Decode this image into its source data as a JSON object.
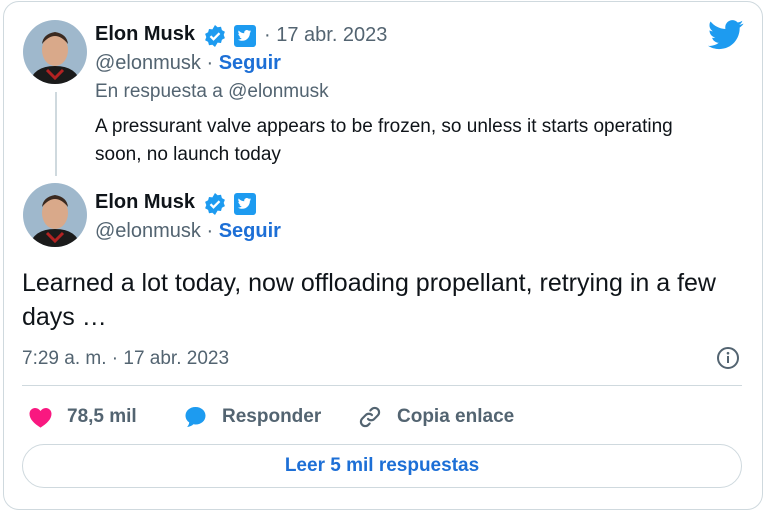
{
  "reply_tweet": {
    "author_name": "Elon Musk",
    "date": "· 17 abr. 2023",
    "handle": "@elonmusk ·",
    "follow_label": "Seguir",
    "reply_to": "En respuesta a @elonmusk",
    "text": "A pressurant valve appears to be frozen, so unless it starts operating soon, no launch today"
  },
  "main_tweet": {
    "author_name": "Elon Musk",
    "handle": "@elonmusk ·",
    "follow_label": "Seguir",
    "text": "Learned a lot today, now offloading propellant, retrying in a few days …",
    "timestamp": "7:29 a. m. · 17 abr. 2023"
  },
  "actions": {
    "likes": "78,5 mil",
    "reply_label": "Responder",
    "copy_link_label": "Copia enlace"
  },
  "read_replies_label": "Leer 5 mil respuestas",
  "colors": {
    "accent": "#1d9bf0",
    "verified": "#1d9bf0",
    "like": "#f91880",
    "link": "#1d6fd6"
  },
  "icons": [
    "twitter-bird-icon",
    "verified-badge-icon",
    "twitter-affiliate-icon",
    "heart-icon",
    "reply-bubble-icon",
    "link-icon",
    "info-icon"
  ]
}
